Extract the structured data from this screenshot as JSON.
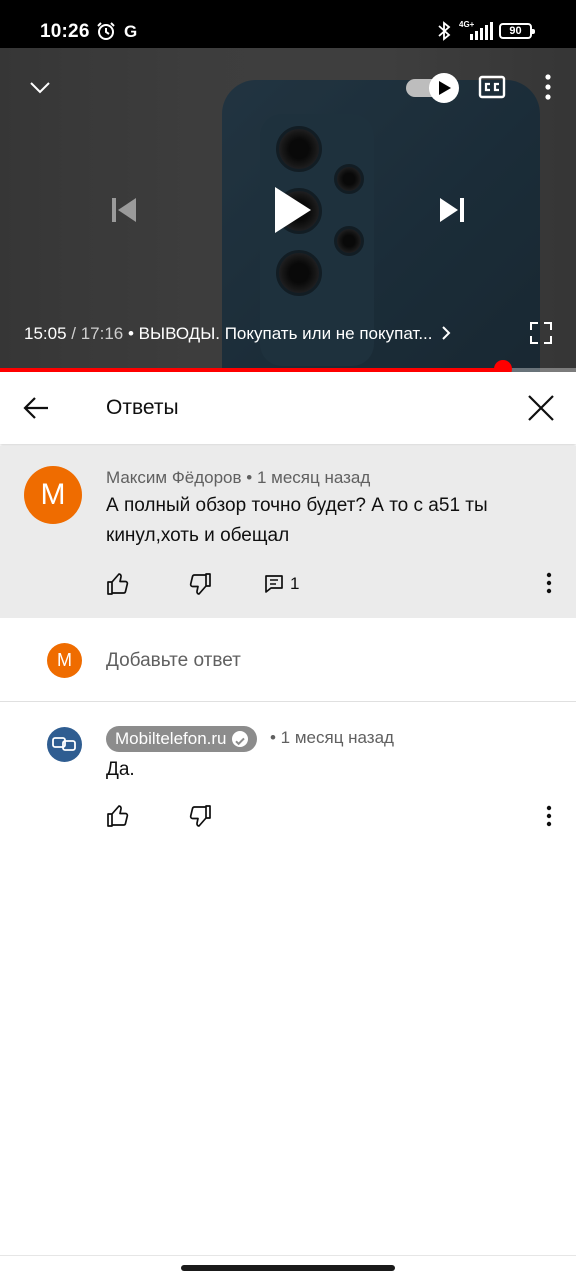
{
  "status_bar": {
    "time": "10:26",
    "g_label": "G",
    "network": "4G+",
    "battery": "90"
  },
  "player": {
    "current_time": "15:05",
    "separator": " / ",
    "duration": "17:16",
    "chapter_title": "• ВЫВОДЫ. Покупать или не покупат...",
    "progress_fraction": 0.873,
    "icons": [
      "chevron-down-icon",
      "autoplay-toggle-icon",
      "captions-icon",
      "more-vert-icon",
      "previous-icon",
      "play-icon",
      "next-icon",
      "chevron-right-icon",
      "fullscreen-icon"
    ]
  },
  "header": {
    "title": "Ответы"
  },
  "parent_comment": {
    "avatar_letter": "М",
    "author": "Максим Фёдоров",
    "time": "• 1 месяц назад",
    "text": "А полный обзор точно будет? А то с а51 ты кинул,хоть и обещал",
    "reply_count": "1"
  },
  "add_reply": {
    "avatar_letter": "М",
    "placeholder": "Добавьте ответ"
  },
  "reply": {
    "author": "Mobiltelefon.ru",
    "time": "• 1 месяц назад",
    "text": "Да."
  },
  "colors": {
    "accent_red": "#ff0000",
    "avatar_orange": "#ef6c00",
    "channel_avatar_blue": "#2f5d91",
    "parent_bg": "#ebebeb"
  }
}
